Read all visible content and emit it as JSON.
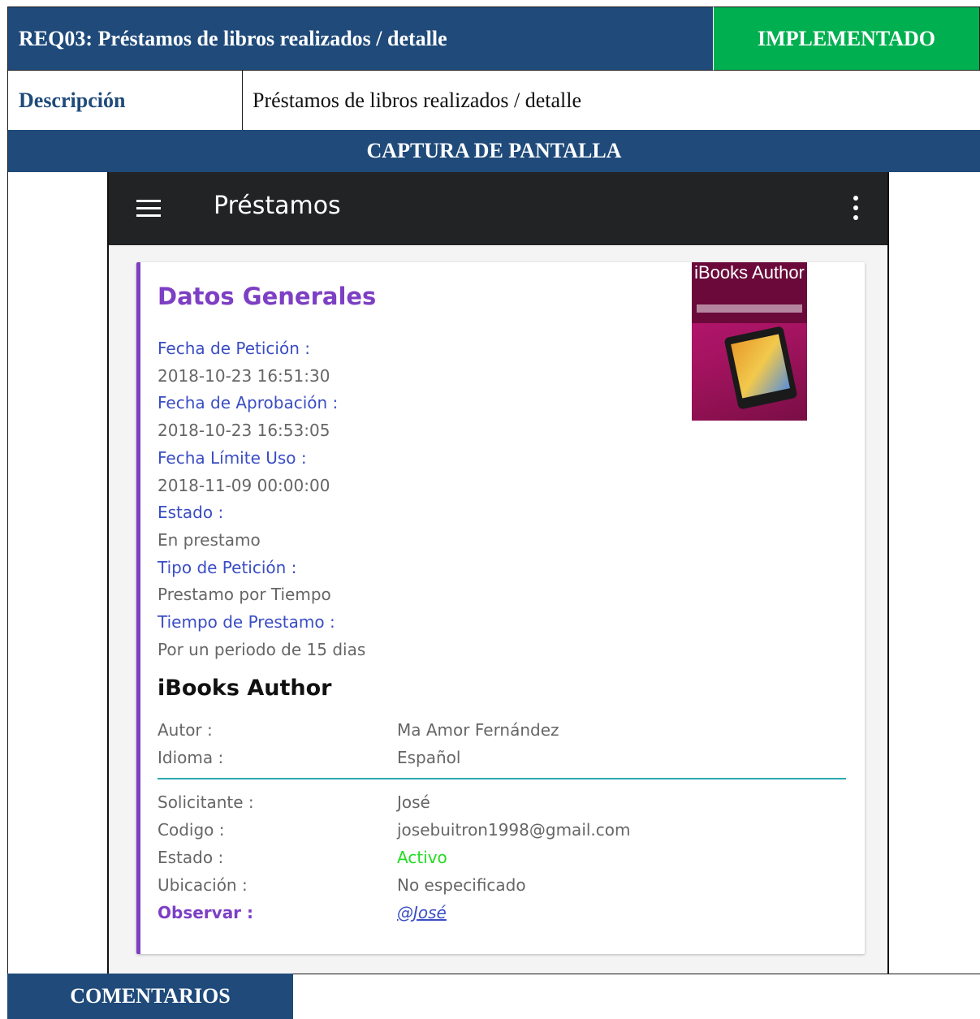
{
  "header": {
    "requirement_title": "REQ03: Préstamos de libros realizados / detalle",
    "status": "IMPLEMENTADO"
  },
  "description": {
    "label": "Descripción",
    "value": "Préstamos de libros realizados / detalle"
  },
  "screenshot_section": {
    "title": "CAPTURA DE PANTALLA"
  },
  "app": {
    "appbar_title": "Préstamos",
    "icons": [
      "menu-icon",
      "more-vert-icon"
    ],
    "card": {
      "title": "Datos Generales",
      "fields": [
        {
          "label": "Fecha de Petición :",
          "value": "2018-10-23 16:51:30"
        },
        {
          "label": "Fecha de Aprobación :",
          "value": "2018-10-23 16:53:05"
        },
        {
          "label": "Fecha Límite Uso :",
          "value": "2018-11-09 00:00:00"
        },
        {
          "label": "Estado :",
          "value": "En prestamo"
        },
        {
          "label": "Tipo de Petición :",
          "value": "Prestamo por Tiempo"
        },
        {
          "label": "Tiempo de Prestamo :",
          "value": "Por un periodo de 15 dias"
        }
      ],
      "book": {
        "title": "iBooks Author",
        "cover_text": "iBooks Author",
        "details": [
          {
            "key": "Autor :",
            "value": "Ma Amor Fernández"
          },
          {
            "key": "Idioma :",
            "value": "Español"
          }
        ]
      },
      "requester": [
        {
          "key": "Solicitante :",
          "value": "José"
        },
        {
          "key": "Codigo :",
          "value": "josebuitron1998@gmail.com"
        },
        {
          "key": "Estado :",
          "value": "Activo"
        },
        {
          "key": "Ubicación :",
          "value": "No especificado"
        },
        {
          "key": "Observar :",
          "value": "@José"
        }
      ],
      "colors": {
        "accent": "#7d3fc4",
        "label": "#3a4dc4",
        "divider": "#2aa8b0",
        "active": "#22dd22"
      }
    }
  },
  "comments": {
    "label": "COMENTARIOS"
  },
  "colors": {
    "header_blue": "#1f4a7a",
    "status_green": "#00b050"
  }
}
